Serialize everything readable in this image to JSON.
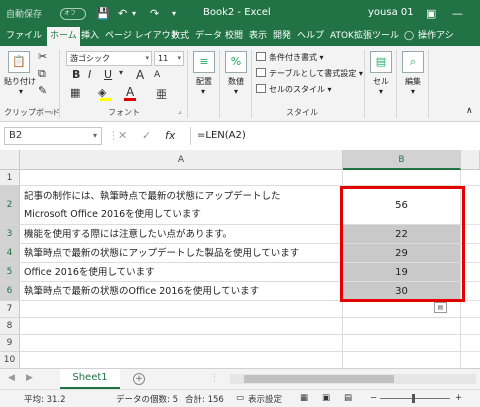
{
  "titlebar": {
    "autosave_label": "自動保存",
    "autosave_state": "オフ",
    "title": "Book2  -  Excel",
    "user": "yousa 01",
    "bg_color": "#217346"
  },
  "tabs": [
    {
      "label": "ファイル",
      "active": false
    },
    {
      "label": "ホーム",
      "active": true
    },
    {
      "label": "挿入",
      "active": false
    },
    {
      "label": "ページ レイアウト",
      "active": false
    },
    {
      "label": "数式",
      "active": false
    },
    {
      "label": "データ",
      "active": false
    },
    {
      "label": "校閲",
      "active": false
    },
    {
      "label": "表示",
      "active": false
    },
    {
      "label": "開発",
      "active": false
    },
    {
      "label": "ヘルプ",
      "active": false
    },
    {
      "label": "ATOK拡張ツール",
      "active": false
    },
    {
      "label": "操作アシ",
      "active": false
    }
  ],
  "ribbon": {
    "clipboard": {
      "paste_label": "貼り付け",
      "group_label": "クリップボード"
    },
    "font": {
      "font_name": "游ゴシック",
      "font_size": "11",
      "bold": "B",
      "italic": "I",
      "underline": "U",
      "grow": "A",
      "shrink": "A",
      "color_a": "A",
      "group_label": "フォント"
    },
    "alignment_label": "配置",
    "number_label": "数値",
    "styles": {
      "conditional": "条件付き書式",
      "table": "テーブルとして書式設定",
      "cell_style": "セルのスタイル",
      "group_label": "スタイル"
    },
    "cells_label": "セル",
    "edit_label": "編集"
  },
  "formula_bar": {
    "name_box": "B2",
    "cancel_icon": "✕",
    "enter_icon": "✓",
    "fx": "fx",
    "formula": "=LEN(A2)"
  },
  "grid": {
    "columns": [
      "A",
      "B"
    ],
    "row_headers": [
      "1",
      "2",
      "3",
      "4",
      "5",
      "6",
      "7",
      "8",
      "9",
      "10"
    ],
    "rows": [
      {
        "a_line1": "",
        "a_line2": "",
        "b": ""
      },
      {
        "a_line1": "記事の制作には、執筆時点で最新の状態にアップデートした",
        "a_line2": "Microsoft Office 2016を使用しています",
        "b": "56"
      },
      {
        "a_line1": "機能を使用する際には注意したい点があります。",
        "b": "22"
      },
      {
        "a_line1": "執筆時点で最新の状態にアップデートした製品を使用しています",
        "b": "29"
      },
      {
        "a_line1": "Office 2016を使用しています",
        "b": "19"
      },
      {
        "a_line1": "執筆時点で最新の状態のOffice 2016を使用しています",
        "b": "30"
      }
    ],
    "highlight_color": "#e30000",
    "selection_shade": "#c9c9c9"
  },
  "sheet_tabs": {
    "active": "Sheet1",
    "add_icon": "+"
  },
  "status": {
    "average": "平均: 31.2",
    "count": "データの個数: 5",
    "sum": "合計: 156",
    "display_settings": "表示設定"
  }
}
